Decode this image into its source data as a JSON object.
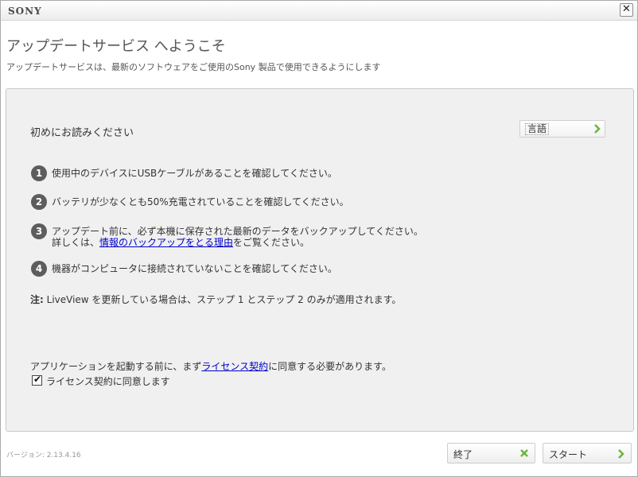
{
  "titlebar": {
    "logo": "SONY",
    "close_glyph": "✕"
  },
  "header": {
    "title": "アップデートサービス へようこそ",
    "subtitle": "アップデートサービスは、最新のソフトウェアをご使用のSony 製品で使用できるようにします"
  },
  "panel": {
    "read_first": "初めにお読みください",
    "language_button": "言語",
    "steps": [
      {
        "num": "1",
        "text": "使用中のデバイスにUSBケーブルがあることを確認してください。"
      },
      {
        "num": "2",
        "text": "バッテリが少なくとも50%充電されていることを確認してください。"
      },
      {
        "num": "3",
        "text": "アップデート前に、必ず本機に保存された最新のデータをバックアップしてください。",
        "line2_prefix": "詳しくは、",
        "line2_link": "情報のバックアップをとる理由",
        "line2_suffix": "をご覧ください。"
      },
      {
        "num": "4",
        "text": "機器がコンピュータに接続されていないことを確認してください。"
      }
    ],
    "note_label": "注:",
    "note_text": " LiveView を更新している場合は、ステップ 1 とステップ 2 のみが適用されます。",
    "license_prefix": "アプリケーションを起動する前に、まず",
    "license_link": "ライセンス契約",
    "license_suffix": "に同意する必要があります。",
    "agree_label": "ライセンス契約に同意します",
    "agree_checked": true
  },
  "footer": {
    "version": "バージョン: 2.13.4.16",
    "exit_button": "終了",
    "start_button": "スタート"
  },
  "colors": {
    "accent_green": "#6db33f",
    "link": "#0000cc",
    "badge": "#5d5d5d"
  },
  "icons": {
    "language": "chevron-right-icon",
    "exit": "close-x-icon",
    "start": "chevron-right-icon"
  }
}
